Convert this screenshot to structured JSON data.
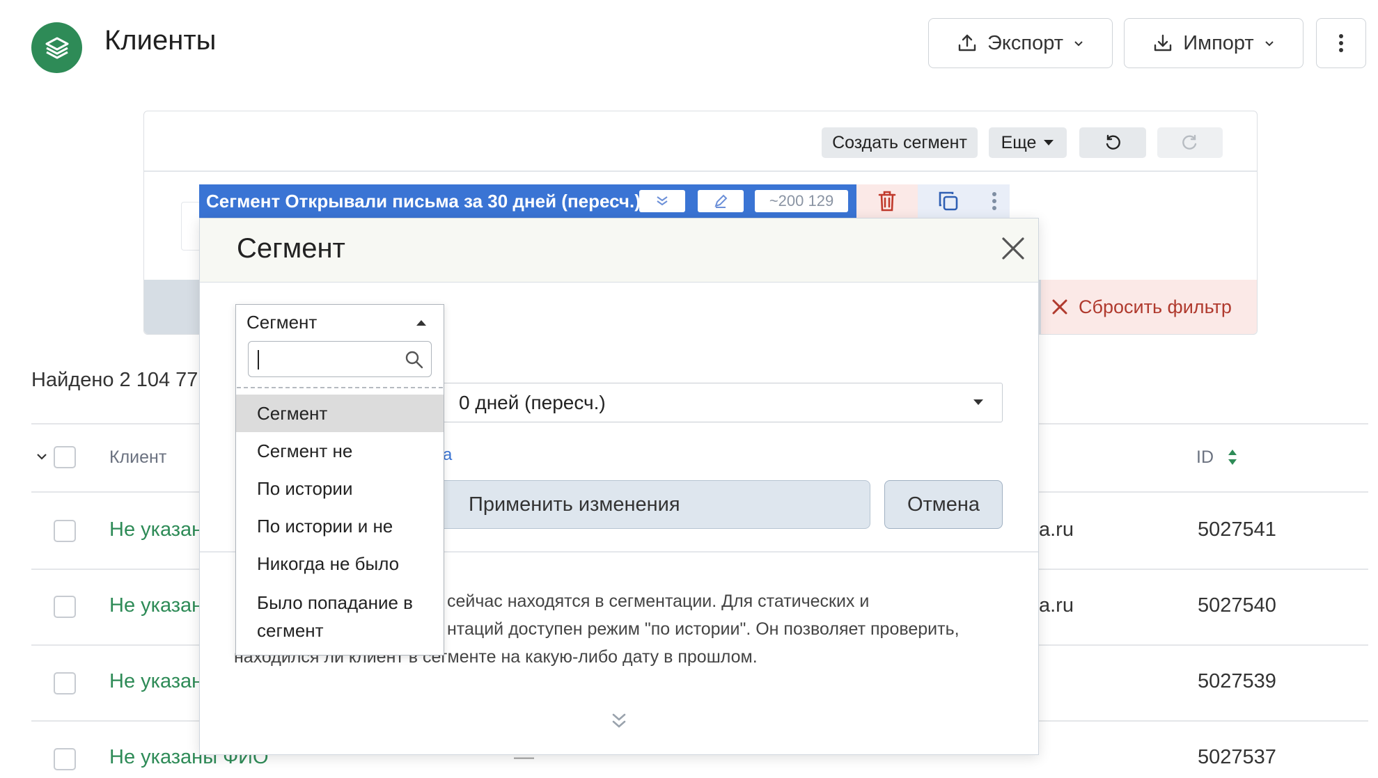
{
  "header": {
    "title": "Клиенты",
    "export_label": "Экспорт",
    "import_label": "Импорт"
  },
  "toolbar": {
    "create_segment": "Создать сегмент",
    "more": "Еще"
  },
  "segment_bar": {
    "label": "Сегмент Открывали письма за 30 дней (пересч.)",
    "count": "~200 129"
  },
  "filter": {
    "reset_label": "Сбросить фильтр"
  },
  "found_text": "Найдено 2 104 77",
  "table": {
    "columns": {
      "client": "Клиент",
      "id": "ID"
    },
    "rows": [
      {
        "client": "Не указан",
        "email": "a.ru",
        "id": "5027541"
      },
      {
        "client": "Не указан",
        "email": "a.ru",
        "id": "5027540"
      },
      {
        "client": "Не указан",
        "email": "",
        "id": "5027539"
      },
      {
        "client": "Не указаны ФИО",
        "email": "—",
        "id": "5027537"
      }
    ]
  },
  "modal": {
    "title": "Сегмент",
    "segment_select_value": "0 дней (пересч.)",
    "partial_link": "а",
    "apply_label": "Применить изменения",
    "cancel_label": "Отмена",
    "description": [
      "сейчас находятся в сегментации. Для статических и",
      "нтаций доступен режим \"по истории\". Он позволяет проверить,",
      "находился ли клиент в сегменте на какую-либо дату в прошлом."
    ]
  },
  "dropdown": {
    "current": "Сегмент",
    "search_placeholder": "",
    "options": [
      "Сегмент",
      "Сегмент не",
      "По истории",
      "По истории и не",
      "Никогда не было",
      "Было попадание в сегмент"
    ],
    "selected_index": 0
  },
  "colors": {
    "brand_green": "#2e8b57",
    "segment_blue": "#3a74d4",
    "danger_red": "#b03a2e"
  }
}
